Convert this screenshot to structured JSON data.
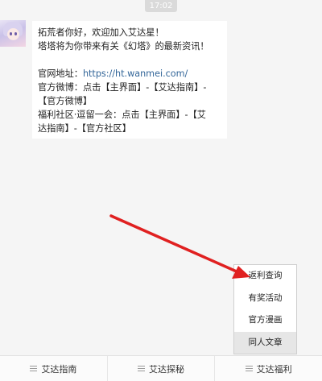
{
  "timestamp": "17:02",
  "message": {
    "line1": "拓荒者你好，欢迎加入艾达星！",
    "line2": "塔塔将为你带来有关《幻塔》的最新资讯！",
    "official_site_label": "官网地址：",
    "official_site_url": "https://ht.wanmei.com/",
    "weibo_line1": "官方微博：点击【主界面】-【艾达指南】-",
    "weibo_line2": "【官方微博】",
    "community_line1": "福利社区·逗留一会：点击【主界面】-【艾",
    "community_line2": "达指南】-【官方社区】"
  },
  "popup_menu": {
    "items": [
      "返利查询",
      "有奖活动",
      "官方漫画",
      "同人文章"
    ],
    "highlighted_item": "同人文章"
  },
  "bottom_menu": {
    "tabs": [
      "艾达指南",
      "艾达探秘",
      "艾达福利"
    ],
    "icon": "menu-icon"
  },
  "annotation": {
    "arrow_color": "#e02020",
    "arrow_target": "返利查询"
  }
}
